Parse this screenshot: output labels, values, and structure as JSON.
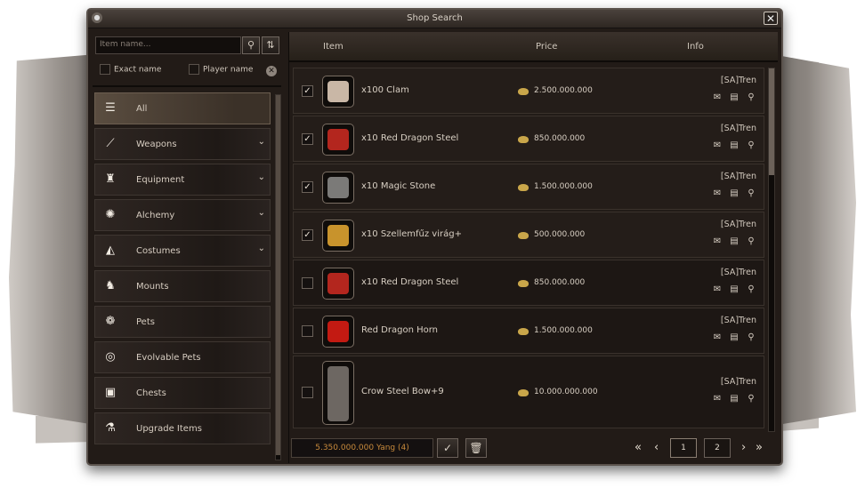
{
  "window": {
    "title": "Shop Search",
    "close_label": "✕"
  },
  "search": {
    "placeholder": "Item name...",
    "exact_label": "Exact name",
    "player_label": "Player name"
  },
  "categories": [
    {
      "label": "All",
      "icon": "list-icon",
      "glyph": "☰",
      "expandable": false,
      "active": true
    },
    {
      "label": "Weapons",
      "icon": "sword-icon",
      "glyph": "⟋",
      "expandable": true
    },
    {
      "label": "Equipment",
      "icon": "armor-icon",
      "glyph": "♜",
      "expandable": true
    },
    {
      "label": "Alchemy",
      "icon": "gem-icon",
      "glyph": "✺",
      "expandable": true
    },
    {
      "label": "Costumes",
      "icon": "mask-icon",
      "glyph": "◭",
      "expandable": true
    },
    {
      "label": "Mounts",
      "icon": "horse-icon",
      "glyph": "♞",
      "expandable": false
    },
    {
      "label": "Pets",
      "icon": "paw-icon",
      "glyph": "❁",
      "expandable": false
    },
    {
      "label": "Evolvable Pets",
      "icon": "spiral-icon",
      "glyph": "◎",
      "expandable": false
    },
    {
      "label": "Chests",
      "icon": "chest-icon",
      "glyph": "▣",
      "expandable": false
    },
    {
      "label": "Upgrade Items",
      "icon": "flask-icon",
      "glyph": "⚗",
      "expandable": false
    }
  ],
  "columns": {
    "item": "Item",
    "price": "Price",
    "info": "Info"
  },
  "items": [
    {
      "name": "x100 Clam",
      "price": "2.500.000.000",
      "seller": "[SA]Tren",
      "checked": true,
      "icon": "clam-icon",
      "color": "#c9b7a6"
    },
    {
      "name": "x10 Red Dragon Steel",
      "price": "850.000.000",
      "seller": "[SA]Tren",
      "checked": true,
      "icon": "red-dragon-steel-icon",
      "color": "#b3261e"
    },
    {
      "name": "x10 Magic Stone",
      "price": "1.500.000.000",
      "seller": "[SA]Tren",
      "checked": true,
      "icon": "magic-stone-icon",
      "color": "#7b7a78"
    },
    {
      "name": "x10 Szellemfűz virág+",
      "price": "500.000.000",
      "seller": "[SA]Tren",
      "checked": true,
      "icon": "flower-icon",
      "color": "#c8932c"
    },
    {
      "name": "x10 Red Dragon Steel",
      "price": "850.000.000",
      "seller": "[SA]Tren",
      "checked": false,
      "icon": "red-dragon-steel-icon",
      "color": "#b3261e"
    },
    {
      "name": "Red Dragon Horn",
      "price": "1.500.000.000",
      "seller": "[SA]Tren",
      "checked": false,
      "icon": "dragon-horn-icon",
      "color": "#c31a12"
    },
    {
      "name": "Crow Steel Bow+9",
      "price": "10.000.000.000",
      "seller": "[SA]Tren",
      "checked": false,
      "icon": "bow-icon",
      "color": "#6d6762"
    }
  ],
  "footer": {
    "total": "5.350.000.000 Yang (4)",
    "pages": [
      "1",
      "2"
    ],
    "current_page": "1"
  },
  "colors": {
    "accent": "#c88a3c",
    "background": "#221b17"
  }
}
